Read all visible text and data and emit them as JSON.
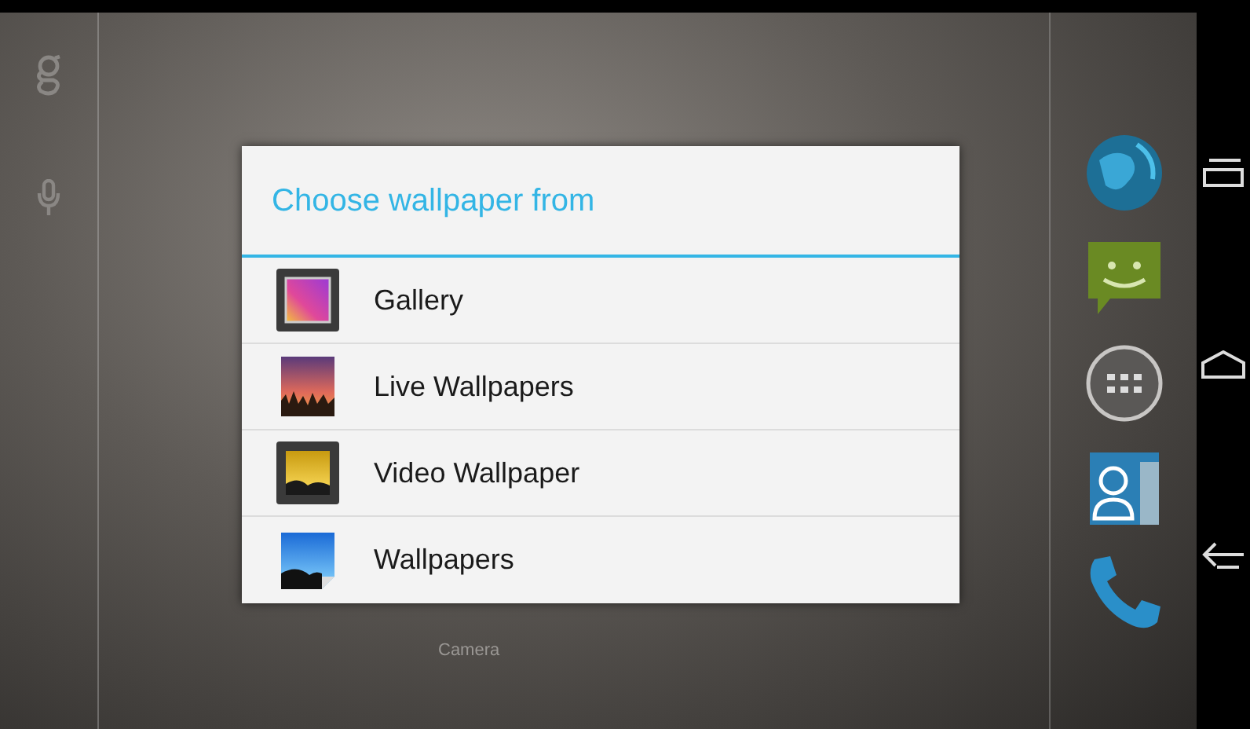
{
  "home_screen": {
    "shortcut_label": "Camera"
  },
  "dialog": {
    "title": "Choose wallpaper from",
    "items": [
      {
        "label": "Gallery"
      },
      {
        "label": "Live Wallpapers"
      },
      {
        "label": "Video Wallpaper"
      },
      {
        "label": "Wallpapers"
      }
    ]
  }
}
